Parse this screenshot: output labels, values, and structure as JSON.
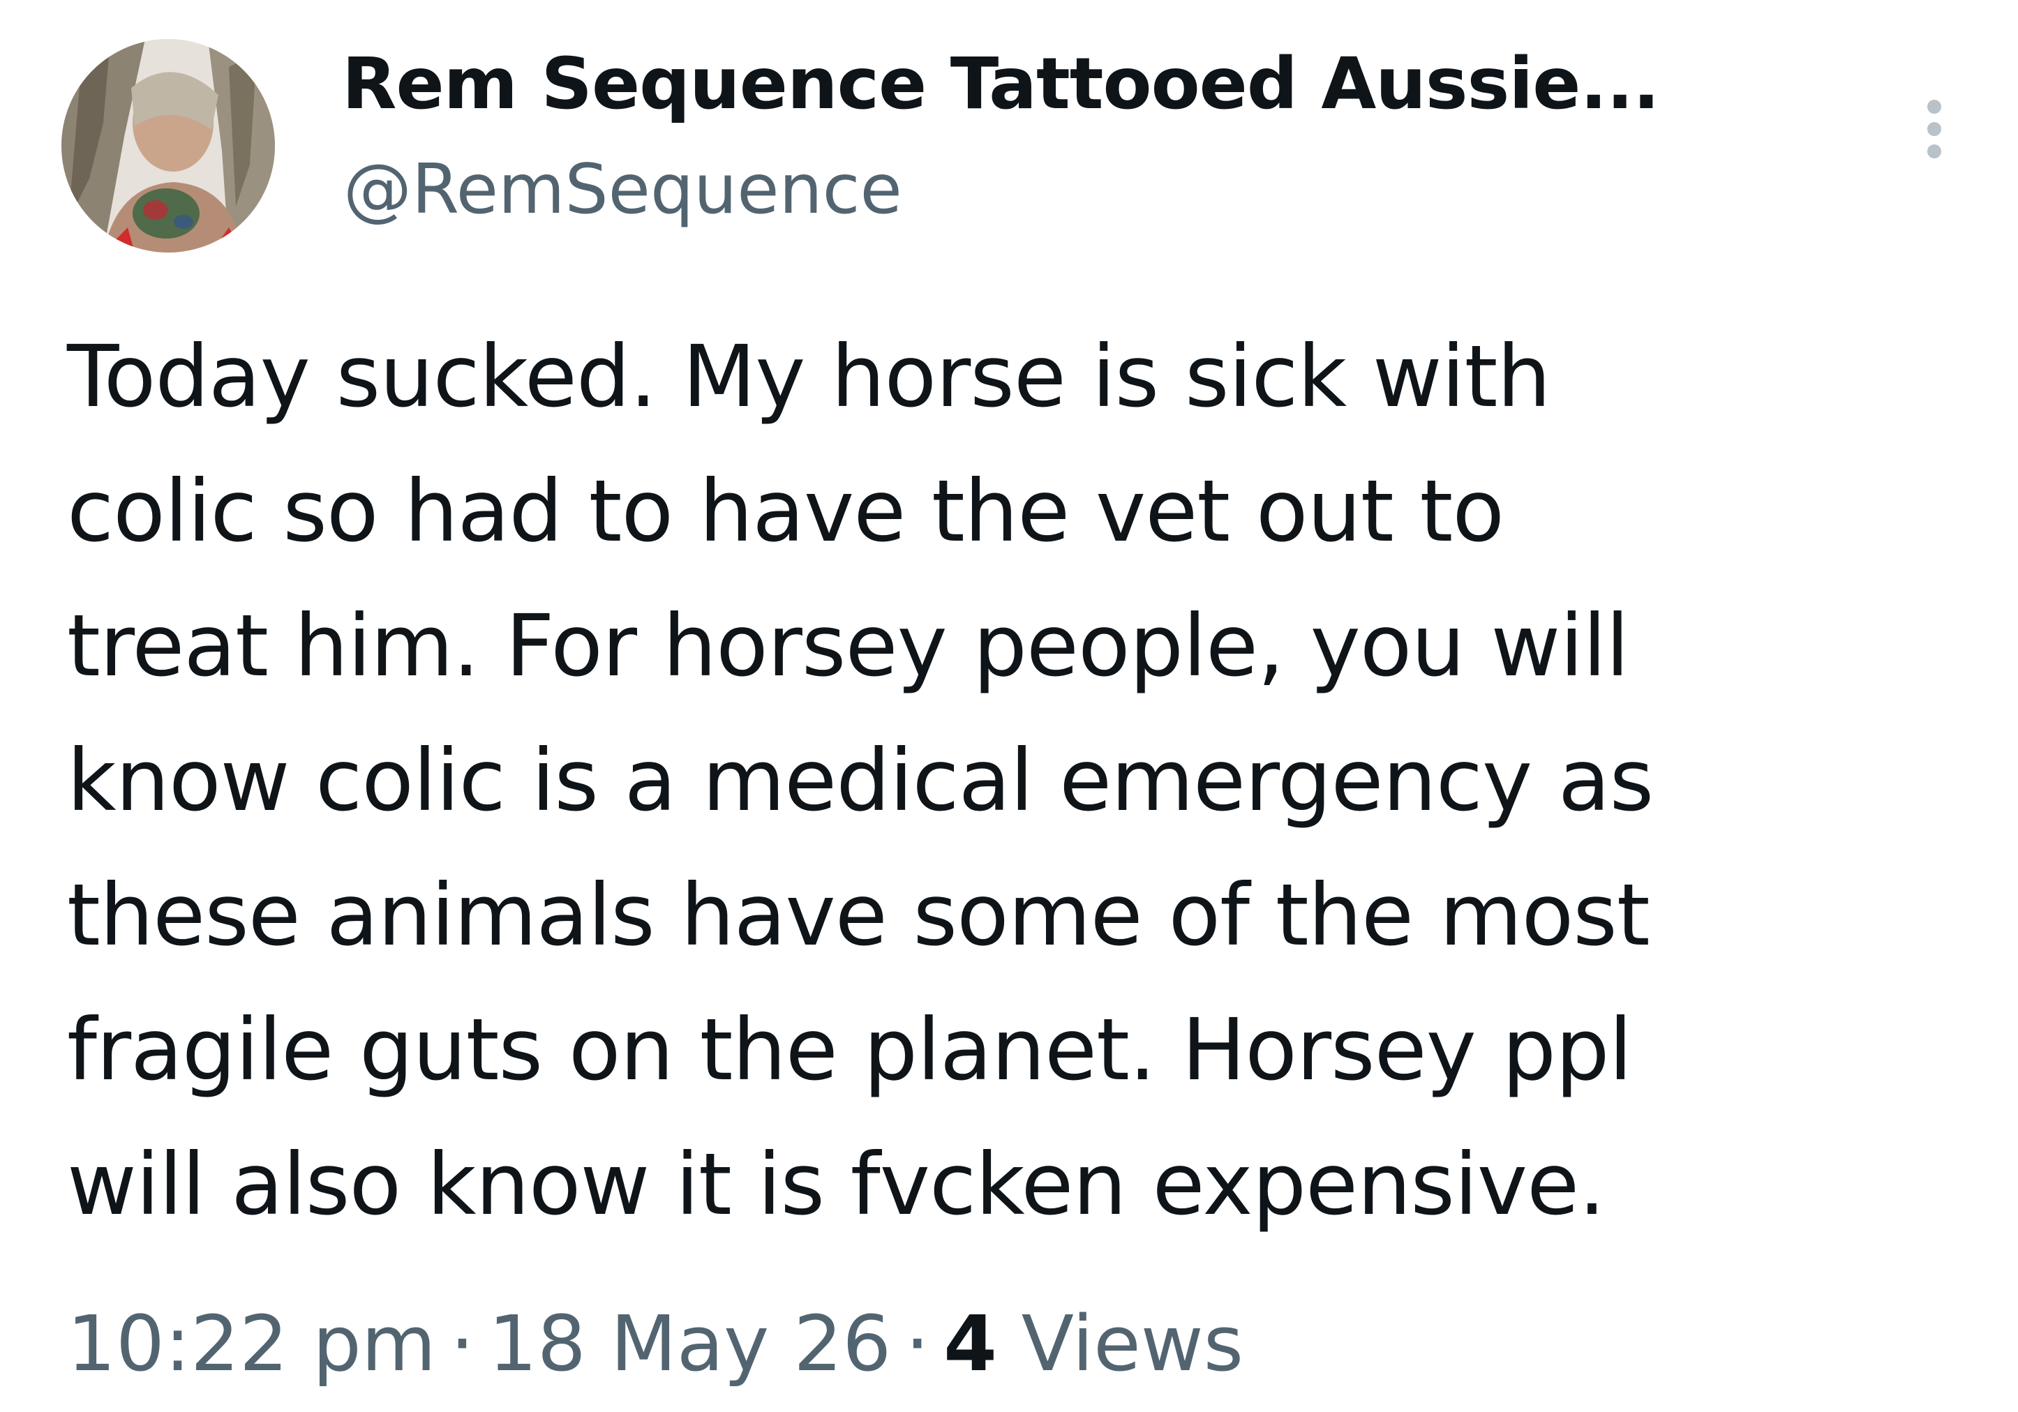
{
  "author": {
    "display_name": "Rem Sequence Tattooed Aussie...",
    "handle": "@RemSequence",
    "avatar_icon": "profile-photo"
  },
  "tweet": {
    "text": "Today sucked. My horse is sick with\ncolic  so had to have the vet out to\ntreat him. For horsey people, you will\nknow colic is a medical emergency as\nthese animals have some of the most\nfragile guts on the planet. Horsey ppl\nwill also know it is fvcken expensive."
  },
  "meta": {
    "time": "10:22 pm",
    "separator": "·",
    "date": "18 May 26",
    "views_count": "4",
    "views_label": "Views"
  },
  "more_icon": "vertical-ellipsis-icon",
  "colors": {
    "primary_text": "#0f1419",
    "secondary_text": "#536471",
    "background": "#ffffff"
  }
}
